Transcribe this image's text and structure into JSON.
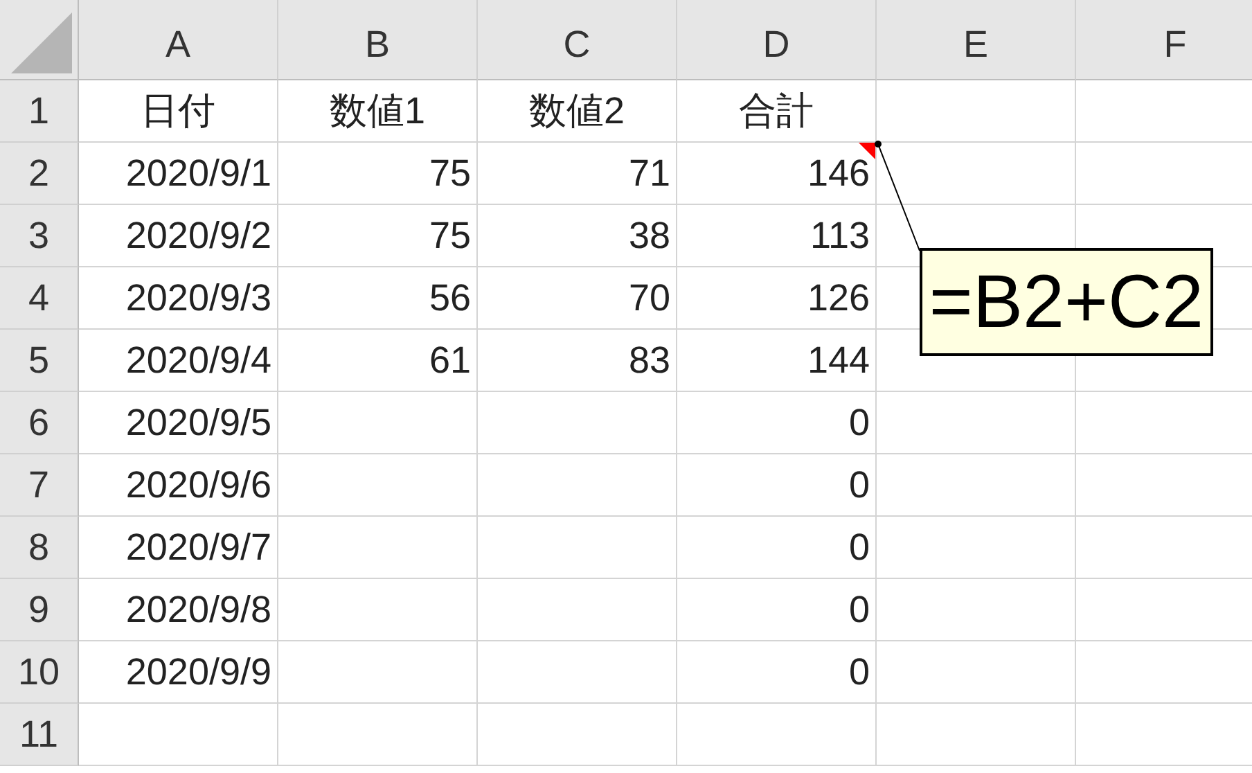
{
  "columns": [
    "A",
    "B",
    "C",
    "D",
    "E",
    "F"
  ],
  "rows": [
    {
      "label": "1",
      "kind": "header",
      "cells": [
        {
          "text": "日付"
        },
        {
          "text": "数値1"
        },
        {
          "text": "数値2"
        },
        {
          "text": "合計"
        }
      ]
    },
    {
      "label": "2",
      "kind": "data",
      "cells": [
        {
          "text": "2020/9/1"
        },
        {
          "text": "75"
        },
        {
          "text": "71"
        },
        {
          "text": "146",
          "has_comment": true
        }
      ]
    },
    {
      "label": "3",
      "kind": "data",
      "cells": [
        {
          "text": "2020/9/2"
        },
        {
          "text": "75"
        },
        {
          "text": "38"
        },
        {
          "text": "113"
        }
      ]
    },
    {
      "label": "4",
      "kind": "data",
      "cells": [
        {
          "text": "2020/9/3"
        },
        {
          "text": "56"
        },
        {
          "text": "70"
        },
        {
          "text": "126"
        }
      ]
    },
    {
      "label": "5",
      "kind": "data",
      "cells": [
        {
          "text": "2020/9/4"
        },
        {
          "text": "61"
        },
        {
          "text": "83"
        },
        {
          "text": "144"
        }
      ]
    },
    {
      "label": "6",
      "kind": "data",
      "cells": [
        {
          "text": "2020/9/5"
        },
        {},
        {},
        {
          "text": "0"
        }
      ]
    },
    {
      "label": "7",
      "kind": "data",
      "cells": [
        {
          "text": "2020/9/6"
        },
        {},
        {},
        {
          "text": "0"
        }
      ]
    },
    {
      "label": "8",
      "kind": "data",
      "cells": [
        {
          "text": "2020/9/7"
        },
        {},
        {},
        {
          "text": "0"
        }
      ]
    },
    {
      "label": "9",
      "kind": "data",
      "cells": [
        {
          "text": "2020/9/8"
        },
        {},
        {},
        {
          "text": "0"
        }
      ]
    },
    {
      "label": "10",
      "kind": "data",
      "cells": [
        {
          "text": "2020/9/9"
        },
        {},
        {},
        {
          "text": "0"
        }
      ]
    },
    {
      "label": "11",
      "kind": "data",
      "cells": []
    }
  ],
  "comment": {
    "text": "=B2+C2"
  }
}
